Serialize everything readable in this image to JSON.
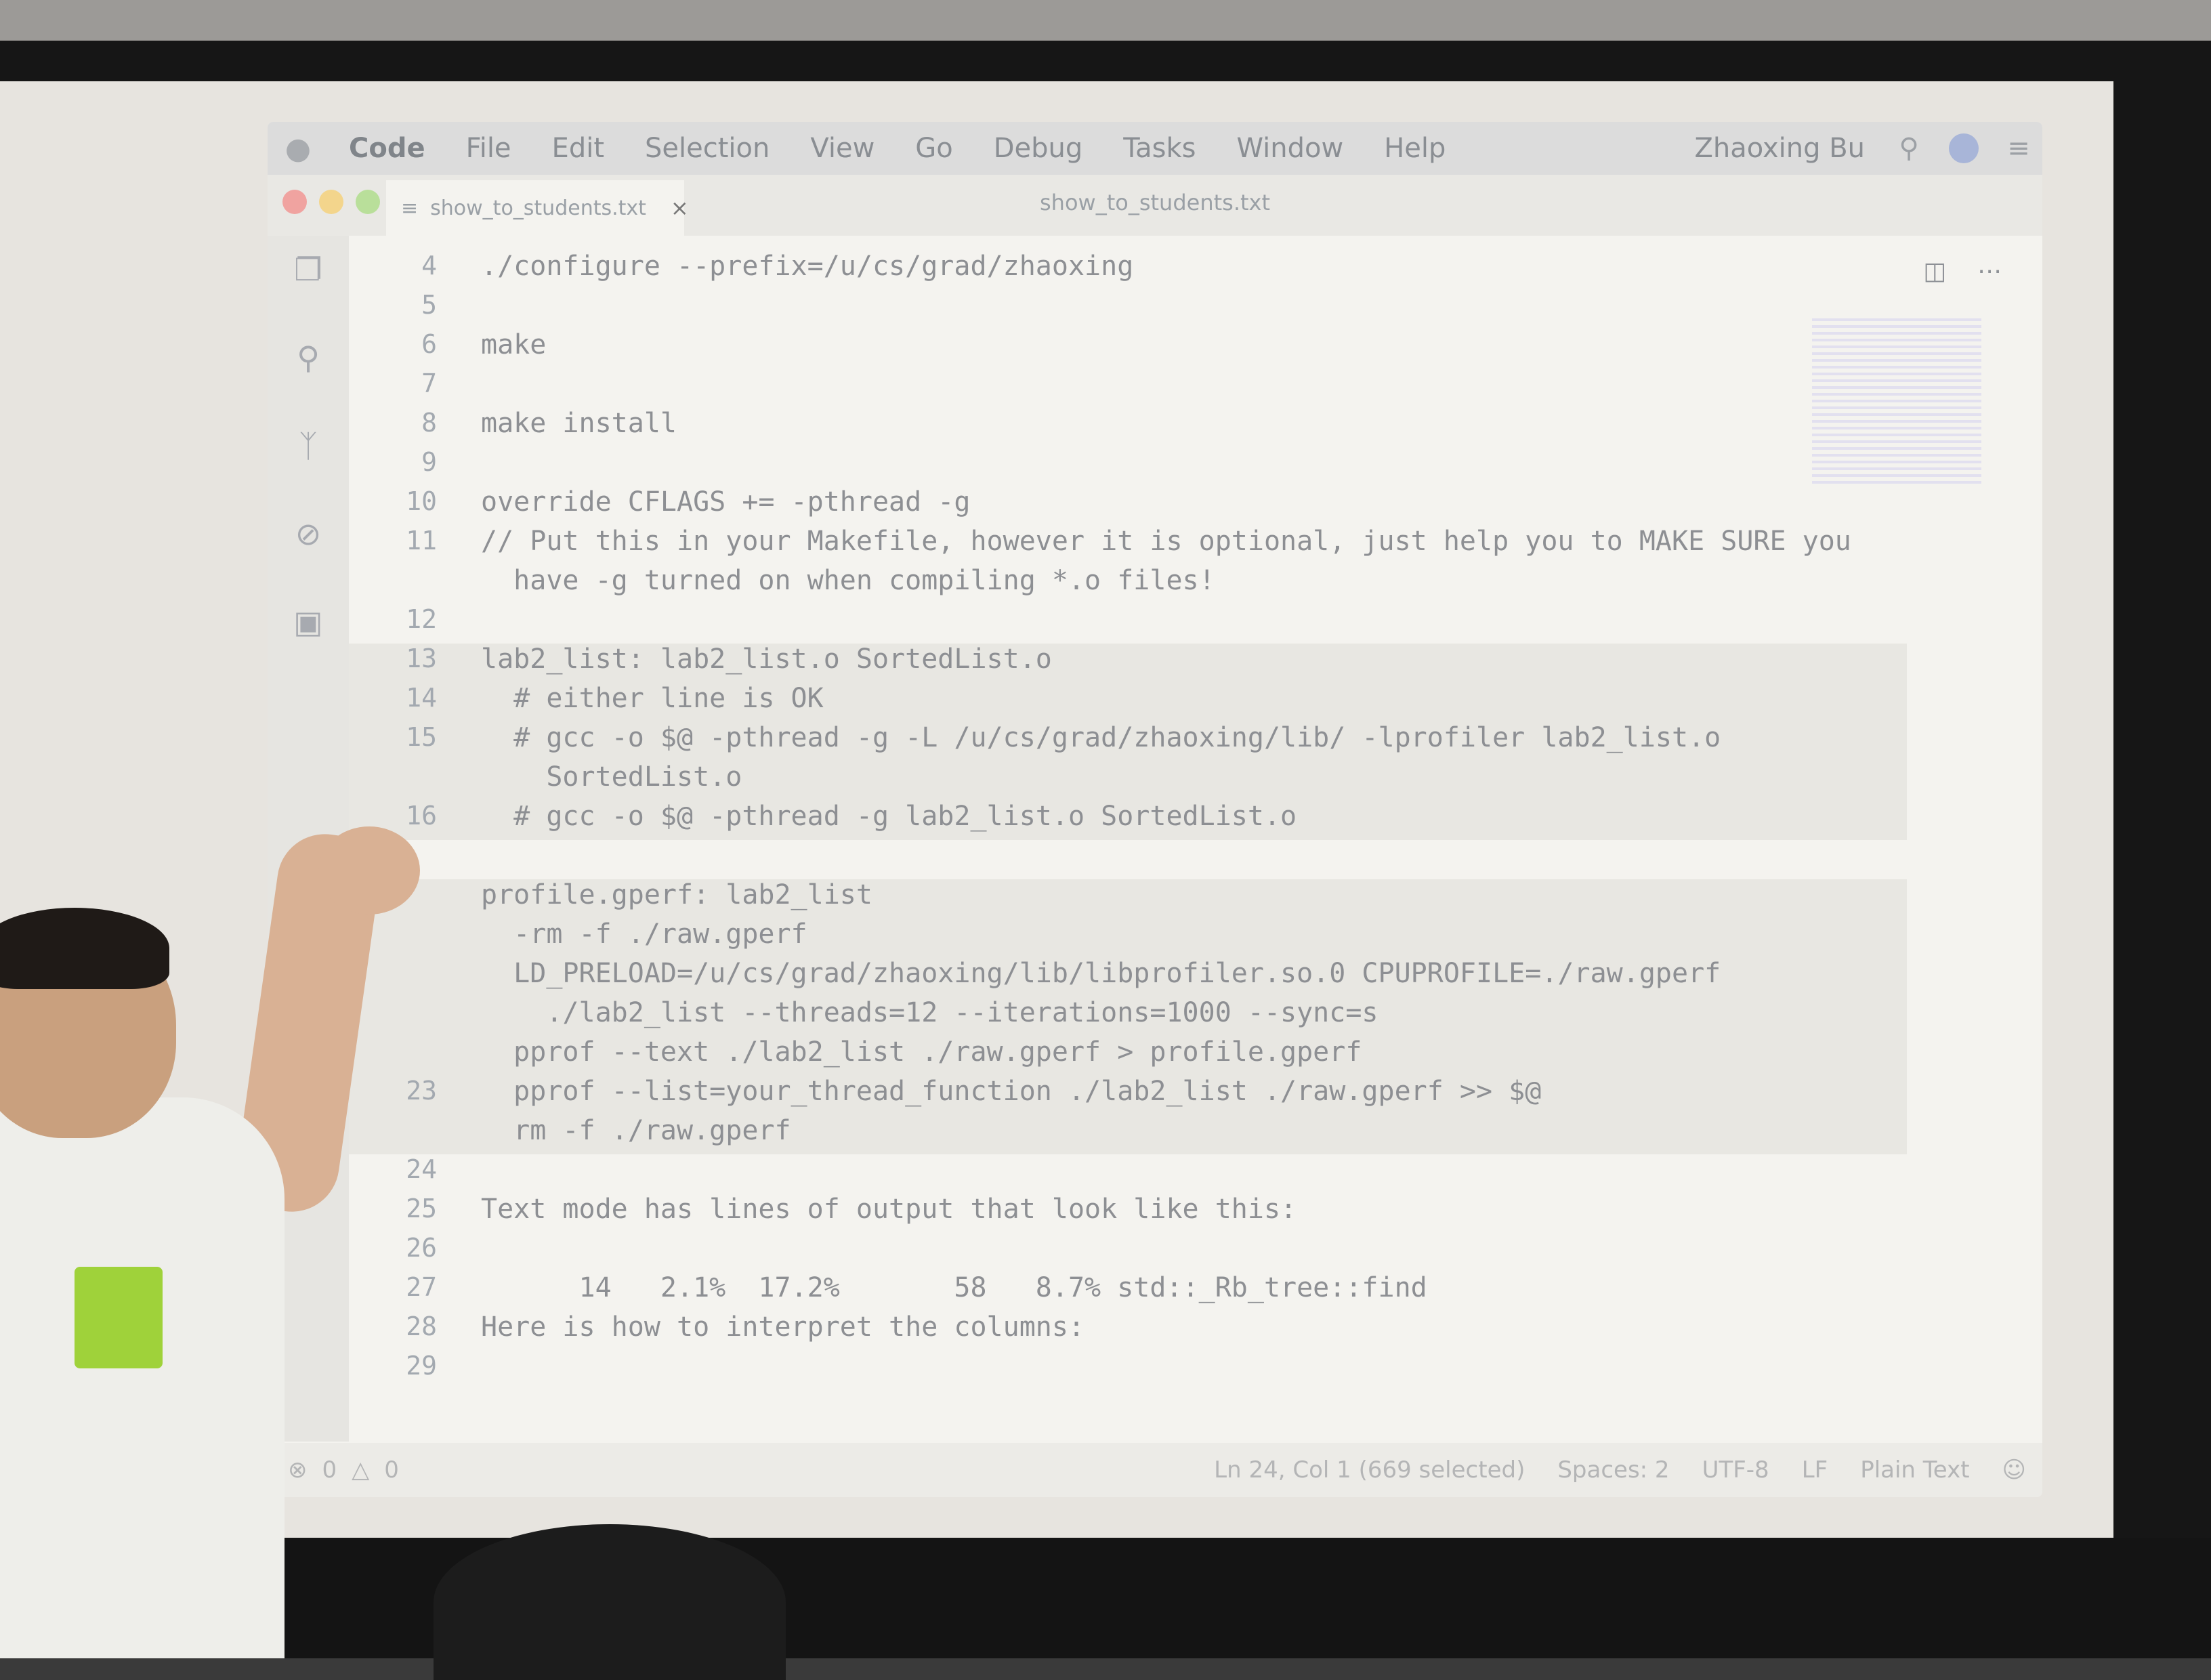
{
  "menubar": {
    "app_name": "Code",
    "items": [
      "File",
      "Edit",
      "Selection",
      "View",
      "Go",
      "Debug",
      "Tasks",
      "Window",
      "Help"
    ],
    "user": "Zhaoxing Bu"
  },
  "tab": {
    "filename": "show_to_students.txt",
    "close": "×"
  },
  "window_title": "show_to_students.txt",
  "lines": [
    {
      "n": "4",
      "text": "./configure --prefix=/u/cs/grad/zhaoxing"
    },
    {
      "n": "5",
      "text": ""
    },
    {
      "n": "6",
      "text": "make"
    },
    {
      "n": "7",
      "text": ""
    },
    {
      "n": "8",
      "text": "make install"
    },
    {
      "n": "9",
      "text": ""
    },
    {
      "n": "10",
      "text": "override CFLAGS += -pthread -g"
    },
    {
      "n": "11",
      "text": "// Put this in your Makefile, however it is optional, just help you to MAKE SURE you"
    },
    {
      "n": "",
      "text": "  have -g turned on when compiling *.o files!"
    },
    {
      "n": "12",
      "text": ""
    },
    {
      "n": "13",
      "text": "lab2_list: lab2_list.o SortedList.o"
    },
    {
      "n": "14",
      "text": "  # either line is OK"
    },
    {
      "n": "15",
      "text": "  # gcc -o $@ -pthread -g -L /u/cs/grad/zhaoxing/lib/ -lprofiler lab2_list.o"
    },
    {
      "n": "",
      "text": "    SortedList.o"
    },
    {
      "n": "16",
      "text": "  # gcc -o $@ -pthread -g lab2_list.o SortedList.o"
    },
    {
      "n": "",
      "text": ""
    },
    {
      "n": "",
      "text": "profile.gperf: lab2_list"
    },
    {
      "n": "",
      "text": "  -rm -f ./raw.gperf"
    },
    {
      "n": "",
      "text": "  LD_PRELOAD=/u/cs/grad/zhaoxing/lib/libprofiler.so.0 CPUPROFILE=./raw.gperf"
    },
    {
      "n": "",
      "text": "    ./lab2_list --threads=12 --iterations=1000 --sync=s"
    },
    {
      "n": "",
      "text": "  pprof --text ./lab2_list ./raw.gperf > profile.gperf"
    },
    {
      "n": "23",
      "text": "  pprof --list=your_thread_function ./lab2_list ./raw.gperf >> $@"
    },
    {
      "n": "",
      "text": "  rm -f ./raw.gperf"
    },
    {
      "n": "24",
      "text": ""
    },
    {
      "n": "25",
      "text": "Text mode has lines of output that look like this:"
    },
    {
      "n": "26",
      "text": ""
    },
    {
      "n": "27",
      "text": "      14   2.1%  17.2%       58   8.7% std::_Rb_tree::find"
    },
    {
      "n": "28",
      "text": "Here is how to interpret the columns:"
    },
    {
      "n": "29",
      "text": ""
    }
  ],
  "statusbar": {
    "errors": "0",
    "warnings": "0",
    "cursor": "Ln 24, Col 1 (669 selected)",
    "spaces": "Spaces: 2",
    "encoding": "UTF-8",
    "eol": "LF",
    "language": "Plain Text"
  },
  "icons": {
    "apple": "apple-icon",
    "search": "search-icon",
    "split": "split-editor-icon",
    "more": "more-actions-icon"
  }
}
